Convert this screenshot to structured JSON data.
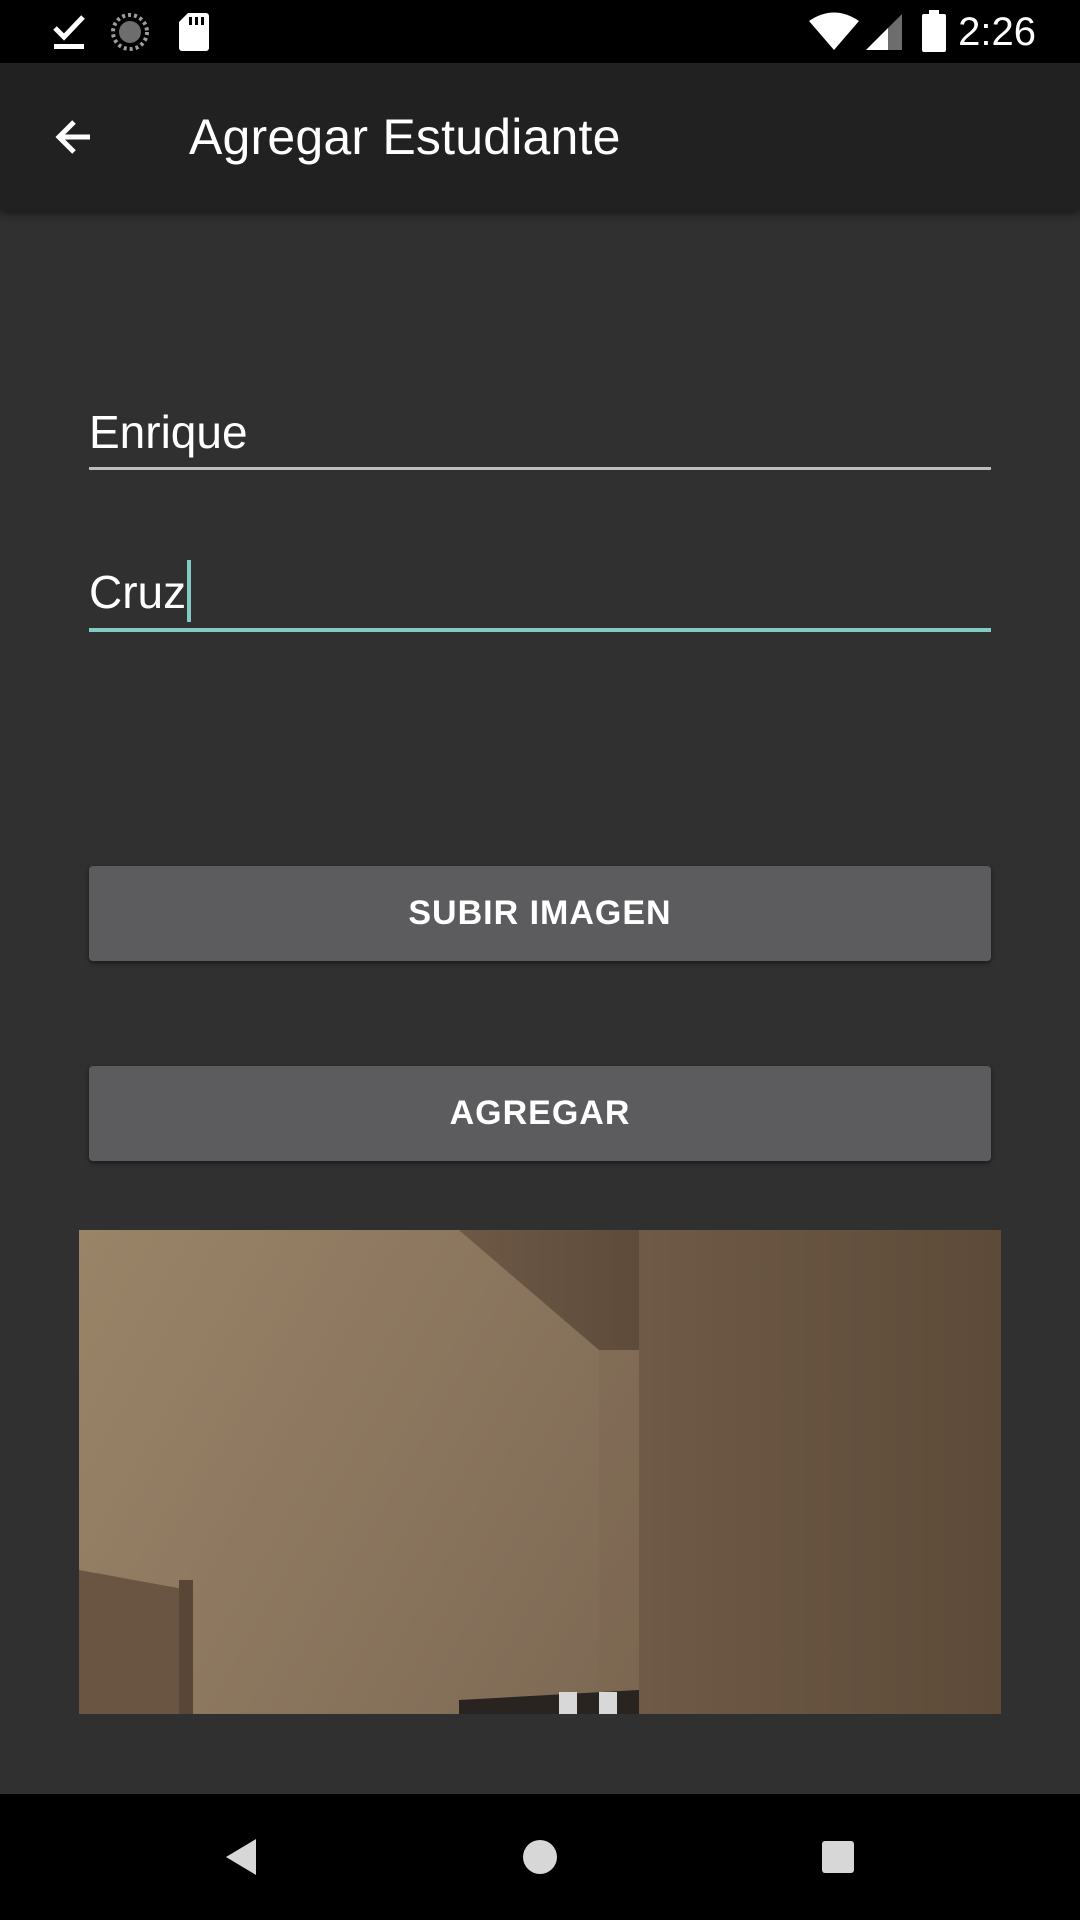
{
  "status_bar": {
    "time": "2:26",
    "icons": [
      "download-done-icon",
      "loading-spinner-icon",
      "sd-card-icon",
      "wifi-icon",
      "cell-signal-icon",
      "battery-icon"
    ]
  },
  "app_bar": {
    "title": "Agregar Estudiante",
    "back_icon": "arrow-back-icon"
  },
  "form": {
    "first_name": {
      "value": "Enrique"
    },
    "last_name": {
      "value": "Cruz",
      "focused": true
    }
  },
  "buttons": {
    "upload_image": "SUBIR IMAGEN",
    "add": "AGREGAR"
  },
  "image": {
    "description_icon": "photo-preview"
  },
  "nav_bar": {
    "icons": [
      "back-triangle-icon",
      "home-circle-icon",
      "recents-square-icon"
    ]
  },
  "colors": {
    "background": "#303030",
    "app_bar": "#212121",
    "accent": "#80cbc4",
    "button": "#5c5c5e"
  }
}
